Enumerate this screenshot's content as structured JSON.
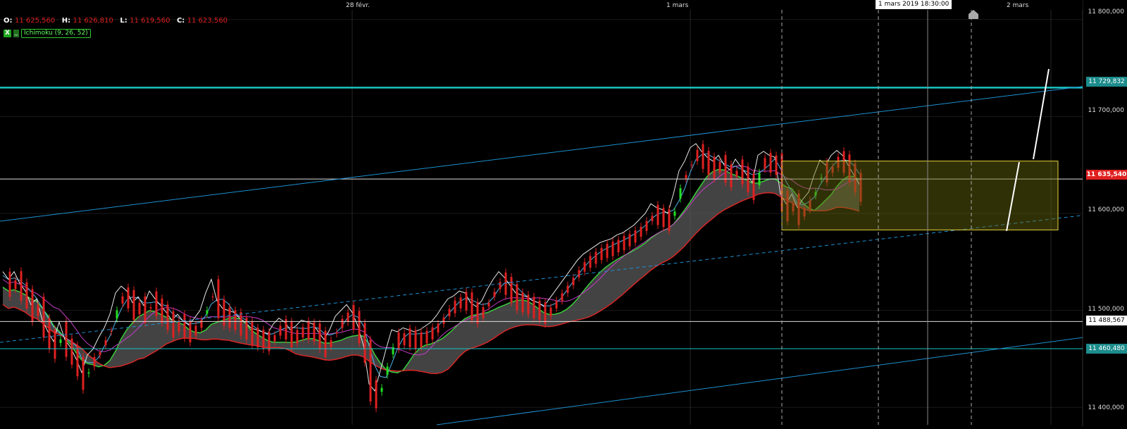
{
  "ohlc": {
    "open_label": "O:",
    "open": "11 625,560",
    "high_label": "H:",
    "high": "11 626,810",
    "low_label": "L:",
    "low": "11 619,560",
    "close_label": "C:",
    "close": "11 623,560"
  },
  "indicator": {
    "checkbox": "X",
    "dash": "_",
    "label": "Ichimoku (9, 26, 52)"
  },
  "crosshair_time": "1 mars 2019 18:30:00",
  "chart_data": {
    "type": "line",
    "x_labels": [
      {
        "label": "28 févr.",
        "index": 62
      },
      {
        "label": "1 mars",
        "index": 122
      },
      {
        "label": "2 mars",
        "index": 186
      }
    ],
    "y_axis": {
      "range": [
        11382,
        11810
      ],
      "ticks": [
        {
          "value": 11800,
          "label": "11 800,000"
        },
        {
          "value": 11700,
          "label": "11 700,000"
        },
        {
          "value": 11600,
          "label": "11 600,000"
        },
        {
          "value": 11500,
          "label": "11 500,000"
        },
        {
          "value": 11400,
          "label": "11 400,000"
        }
      ]
    },
    "price_tags": [
      {
        "value": 11729.832,
        "label": "11 729,832",
        "style": "cyan"
      },
      {
        "value": 11635.54,
        "label": "11 635,540",
        "style": "red"
      },
      {
        "value": 11488.567,
        "label": "11 488,567",
        "style": "white"
      },
      {
        "value": 11460.48,
        "label": "11 460,480",
        "style": "cyan"
      }
    ],
    "series": [
      {
        "name": "",
        "color": "#ffffff",
        "values": [
          11540,
          11532,
          11540,
          11528,
          11520,
          11506,
          11512,
          11490,
          11478,
          11468,
          11488,
          11470,
          11462,
          11450,
          11436,
          11454,
          11460,
          11472,
          11482,
          11496,
          11518,
          11525,
          11520,
          11508,
          11514,
          11505,
          11520,
          11512,
          11505,
          11498,
          11490,
          11496,
          11489,
          11485,
          11492,
          11500,
          11518,
          11532,
          11510,
          11502,
          11500,
          11498,
          11492,
          11488,
          11482,
          11480,
          11478,
          11476,
          11486,
          11492,
          11488,
          11480,
          11484,
          11490,
          11488,
          11486,
          11478,
          11470,
          11480,
          11494,
          11500,
          11506,
          11498,
          11484,
          11464,
          11424,
          11417,
          11438,
          11460,
          11480,
          11478,
          11482,
          11480,
          11478,
          11480,
          11484,
          11488,
          11495,
          11504,
          11512,
          11515,
          11520,
          11518,
          11508,
          11504,
          11510,
          11522,
          11532,
          11540,
          11534,
          11526,
          11518,
          11516,
          11514,
          11510,
          11508,
          11504,
          11512,
          11520,
          11528,
          11536,
          11544,
          11552,
          11558,
          11562,
          11566,
          11570,
          11572,
          11574,
          11578,
          11580,
          11584,
          11588,
          11594,
          11600,
          11610,
          11606,
          11604,
          11600,
          11620,
          11644,
          11654,
          11668,
          11672,
          11664,
          11658,
          11654,
          11660,
          11650,
          11645,
          11656,
          11648,
          11640,
          11632,
          11660,
          11664,
          11660,
          11658,
          11620,
          11610,
          11620,
          11606,
          11615,
          11622,
          11640,
          11655,
          11650,
          11660,
          11665,
          11660,
          11650,
          11640,
          11630
        ]
      }
    ]
  }
}
